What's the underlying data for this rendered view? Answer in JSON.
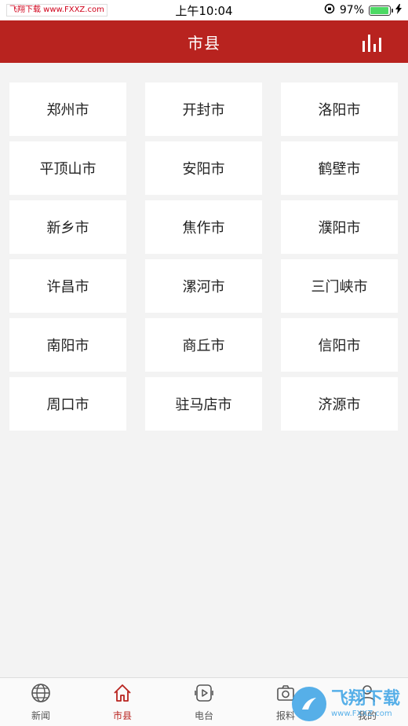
{
  "status_bar": {
    "watermark": "飞翔下载 www.FXXZ.com",
    "time": "上午10:04",
    "battery_percent_text": "97%",
    "battery_level": 0.97
  },
  "nav": {
    "title": "市县",
    "chart_icon": "bar-chart-icon"
  },
  "cities": [
    "郑州市",
    "开封市",
    "洛阳市",
    "平顶山市",
    "安阳市",
    "鹤壁市",
    "新乡市",
    "焦作市",
    "濮阳市",
    "许昌市",
    "漯河市",
    "三门峡市",
    "南阳市",
    "商丘市",
    "信阳市",
    "周口市",
    "驻马店市",
    "济源市"
  ],
  "tabs": [
    {
      "label": "新闻",
      "icon": "globe-icon",
      "active": false
    },
    {
      "label": "市县",
      "icon": "home-icon",
      "active": true
    },
    {
      "label": "电台",
      "icon": "radio-icon",
      "active": false
    },
    {
      "label": "报料",
      "icon": "camera-icon",
      "active": false
    },
    {
      "label": "我的",
      "icon": "user-icon",
      "active": false
    }
  ],
  "corner_watermark": {
    "main": "飞翔下载",
    "sub": "www.FXXZ.com"
  },
  "colors": {
    "accent": "#b8231f",
    "background": "#f3f3f3",
    "battery": "#4cd964"
  }
}
